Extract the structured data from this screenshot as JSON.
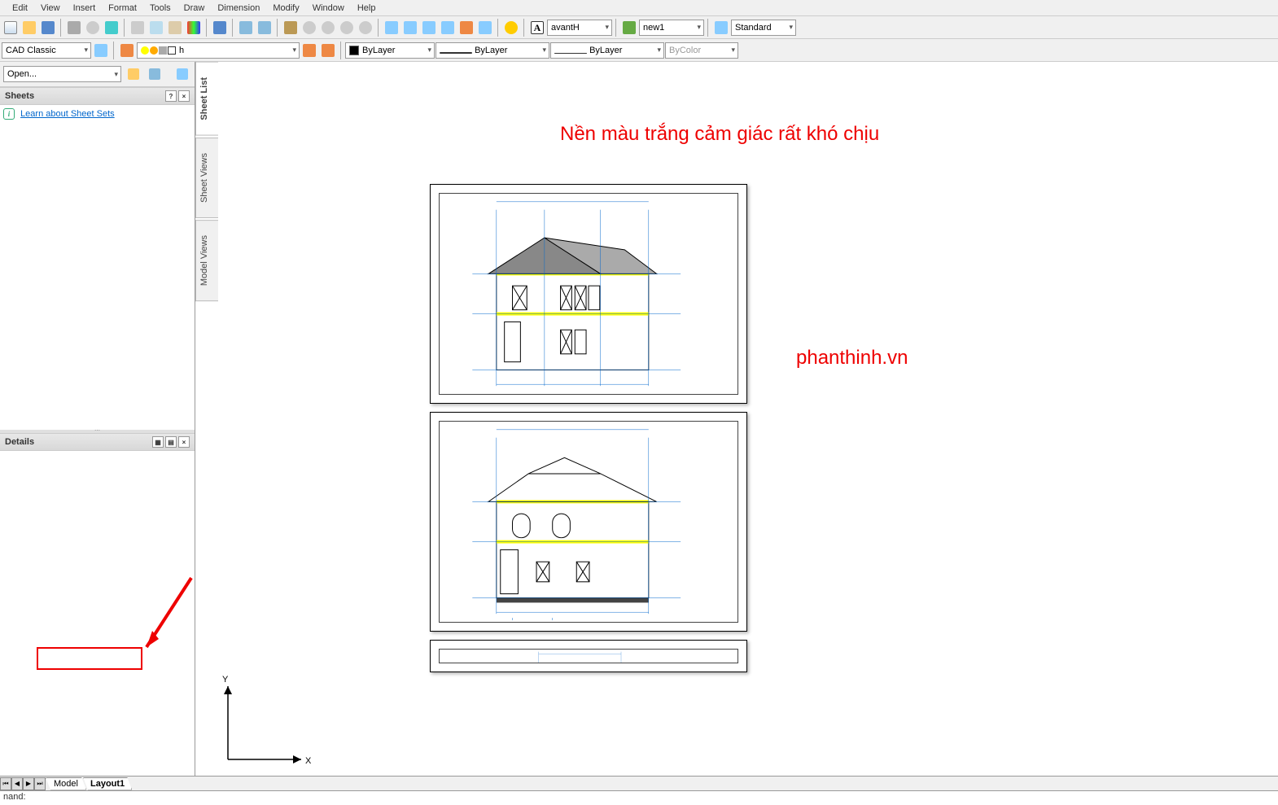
{
  "menu": [
    "Edit",
    "View",
    "Insert",
    "Format",
    "Tools",
    "Draw",
    "Dimension",
    "Modify",
    "Window",
    "Help"
  ],
  "workspace": "CAD Classic",
  "layer": {
    "current": "h"
  },
  "textstyle": {
    "font": "avantH",
    "dimstyle": "new1",
    "tablestyle": "Standard"
  },
  "props": {
    "color": "ByLayer",
    "linetype": "ByLayer",
    "lineweight": "ByLayer",
    "plotstyle": "ByColor"
  },
  "panel": {
    "dropdown": "Open...",
    "sheets_title": "Sheets",
    "sheets_link": "Learn about Sheet Sets",
    "details_title": "Details"
  },
  "sidetabs": [
    "Sheet List",
    "Sheet Views",
    "Model Views"
  ],
  "tabs": {
    "model": "Model",
    "layout1": "Layout1"
  },
  "command": "nand:",
  "anno": {
    "title": "Nền màu trắng cảm giác rất khó chịu",
    "watermark": "phanthinh.vn"
  }
}
